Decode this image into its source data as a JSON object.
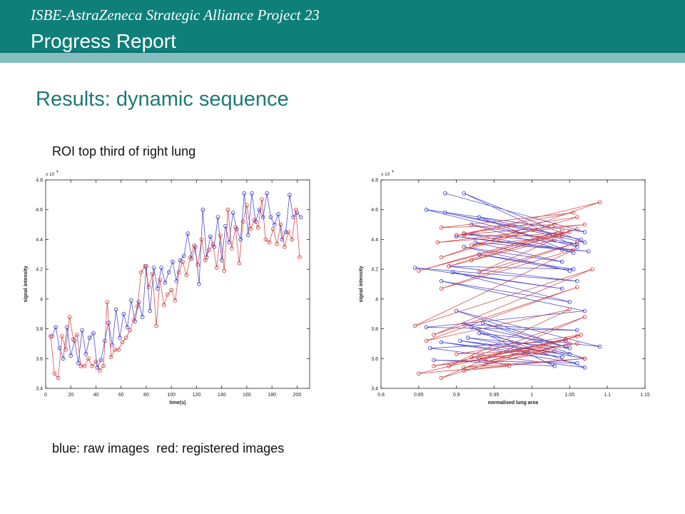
{
  "header": {
    "project_title": "ISBE-AstraZeneca Strategic Alliance Project 23",
    "report_title": "Progress Report"
  },
  "section_title": "Results: dynamic sequence",
  "roi_caption": "ROI top third of right lung",
  "legend": {
    "blue_label": "blue: raw images",
    "red_label": "red: registered images"
  },
  "colors": {
    "header_bg": "#0e7f79",
    "header_strip": "#83bfc0",
    "title_text": "#1b7a76",
    "series_blue": "#3030c8",
    "series_red": "#d03030"
  },
  "chart_data": [
    {
      "type": "line",
      "xlabel": "time(s)",
      "ylabel": "signal intensity",
      "y_multiplier": "x 10^4",
      "xlim": [
        0,
        210
      ],
      "ylim": [
        3.4,
        4.8
      ],
      "xticks": [
        0,
        20,
        40,
        60,
        80,
        100,
        120,
        140,
        160,
        180,
        200
      ],
      "yticks": [
        3.4,
        3.6,
        3.8,
        4.0,
        4.2,
        4.4,
        4.6,
        4.8
      ],
      "ytick_labels": [
        "3.4",
        "3.6",
        "3.8",
        "4",
        "4.2",
        "4.4",
        "4.6",
        "4.8"
      ],
      "series": [
        {
          "name": "raw images",
          "color": "#3030c8",
          "x": [
            5,
            8,
            11,
            14,
            17,
            20,
            23,
            26,
            29,
            32,
            35,
            38,
            41,
            44,
            47,
            50,
            53,
            56,
            59,
            62,
            65,
            68,
            71,
            74,
            77,
            80,
            83,
            86,
            89,
            92,
            95,
            98,
            101,
            104,
            107,
            110,
            113,
            116,
            119,
            122,
            125,
            128,
            131,
            134,
            137,
            140,
            143,
            146,
            149,
            152,
            155,
            158,
            161,
            164,
            167,
            170,
            173,
            176,
            179,
            182,
            185,
            188,
            191,
            194,
            197,
            200,
            203
          ],
          "values": [
            3.75,
            3.81,
            3.67,
            3.6,
            3.81,
            3.62,
            3.72,
            3.57,
            3.79,
            3.63,
            3.74,
            3.77,
            3.54,
            3.59,
            3.72,
            3.84,
            3.69,
            3.93,
            3.74,
            3.9,
            3.81,
            3.99,
            3.85,
            3.98,
            3.88,
            4.22,
            3.92,
            4.21,
            4.07,
            4.21,
            4.11,
            4.18,
            4.25,
            4.12,
            4.26,
            4.29,
            4.44,
            4.27,
            4.35,
            4.1,
            4.6,
            4.28,
            4.42,
            4.35,
            4.55,
            4.26,
            4.49,
            4.38,
            4.58,
            4.47,
            4.4,
            4.71,
            4.43,
            4.71,
            4.52,
            4.6,
            4.55,
            4.71,
            4.55,
            4.5,
            4.57,
            4.4,
            4.45,
            4.7,
            4.55,
            4.58,
            4.55
          ]
        },
        {
          "name": "registered images",
          "color": "#d03030",
          "x": [
            4,
            7,
            10,
            13,
            16,
            19,
            22,
            25,
            28,
            31,
            34,
            37,
            40,
            43,
            46,
            49,
            52,
            55,
            58,
            61,
            64,
            67,
            70,
            73,
            76,
            79,
            82,
            85,
            88,
            91,
            94,
            97,
            100,
            103,
            106,
            109,
            112,
            115,
            118,
            121,
            124,
            127,
            130,
            133,
            136,
            139,
            142,
            145,
            148,
            151,
            154,
            157,
            160,
            163,
            166,
            169,
            172,
            175,
            178,
            181,
            184,
            187,
            190,
            193,
            196,
            199,
            202
          ],
          "values": [
            3.75,
            3.5,
            3.47,
            3.75,
            3.66,
            3.88,
            3.73,
            3.76,
            3.55,
            3.55,
            3.6,
            3.55,
            3.58,
            3.52,
            3.55,
            3.98,
            3.61,
            3.66,
            3.66,
            3.71,
            3.74,
            3.79,
            3.86,
            3.95,
            4.18,
            4.22,
            4.08,
            4.17,
            3.82,
            4.13,
            3.96,
            4.03,
            4.06,
            3.99,
            4.18,
            4.25,
            4.16,
            4.28,
            4.36,
            4.23,
            4.4,
            4.26,
            4.33,
            4.37,
            4.21,
            4.43,
            4.19,
            4.6,
            4.34,
            4.48,
            4.24,
            4.52,
            4.63,
            4.47,
            4.53,
            4.48,
            4.67,
            4.4,
            4.38,
            4.47,
            4.37,
            4.5,
            4.35,
            4.45,
            4.4,
            4.6,
            4.28
          ]
        }
      ]
    },
    {
      "type": "scatter",
      "xlabel": "normalised lung area",
      "ylabel": "signal intensity",
      "y_multiplier": "x 10^4",
      "xlim": [
        0.8,
        1.15
      ],
      "ylim": [
        3.4,
        4.8
      ],
      "xticks": [
        0.8,
        0.85,
        0.9,
        0.95,
        1.0,
        1.05,
        1.1,
        1.15
      ],
      "xtick_labels": [
        "0.8",
        "0.85",
        "0.9",
        "0.95",
        "1",
        "1.05",
        "1.1",
        "1.15"
      ],
      "yticks": [
        3.4,
        3.6,
        3.8,
        4.0,
        4.2,
        4.4,
        4.6,
        4.8
      ],
      "ytick_labels": [
        "3.4",
        "3.6",
        "3.8",
        "4",
        "4.2",
        "4.4",
        "4.6",
        "4.8"
      ],
      "series": [
        {
          "name": "raw images",
          "color": "#3030c8",
          "x": [
            0.885,
            1.07,
            0.86,
            1.06,
            0.91,
            1.07,
            0.885,
            1.065,
            0.93,
            1.055,
            0.92,
            1.06,
            0.91,
            1.04,
            0.9,
            1.075,
            0.925,
            1.04,
            0.91,
            1.05,
            0.93,
            1.055,
            0.89,
            1.06,
            0.845,
            1.04,
            0.895,
            1.05,
            0.88,
            1.07,
            0.86,
            1.06,
            0.91,
            1.045,
            0.935,
            1.07,
            0.915,
            1.05,
            0.9,
            1.09,
            0.93,
            1.05,
            0.905,
            1.04,
            0.88,
            1.06,
            0.87,
            1.03,
            0.92,
            1.07,
            0.865,
            1.045
          ],
          "values": [
            4.71,
            4.45,
            4.6,
            4.35,
            4.71,
            4.38,
            4.58,
            4.4,
            4.55,
            4.31,
            4.5,
            4.37,
            4.44,
            4.33,
            4.42,
            4.32,
            4.38,
            4.25,
            4.35,
            4.19,
            4.3,
            4.2,
            4.22,
            4.12,
            4.21,
            4.07,
            4.18,
            3.98,
            4.12,
            3.92,
            3.81,
            3.79,
            3.83,
            3.68,
            3.84,
            3.6,
            3.74,
            3.67,
            3.92,
            3.68,
            3.77,
            3.63,
            3.72,
            3.61,
            3.71,
            3.57,
            3.59,
            3.55,
            3.81,
            3.54,
            3.67,
            3.72
          ]
        },
        {
          "name": "registered images",
          "color": "#d03030",
          "x": [
            0.91,
            1.09,
            0.88,
            1.06,
            0.91,
            1.055,
            0.88,
            1.03,
            0.92,
            1.04,
            0.9,
            1.07,
            0.875,
            1.05,
            0.92,
            1.06,
            0.85,
            1.04,
            0.89,
            1.03,
            0.93,
            1.06,
            0.88,
            1.055,
            0.845,
            1.08,
            0.87,
            1.06,
            0.86,
            1.05,
            0.89,
            1.07,
            0.88,
            1.06,
            0.93,
            1.03,
            0.91,
            1.07,
            0.85,
            1.045,
            0.87,
            1.02,
            0.9,
            1.065,
            0.94,
            1.05,
            0.91,
            0.97,
            0.92,
            1.06
          ],
          "values": [
            4.43,
            4.65,
            4.28,
            4.55,
            4.44,
            4.58,
            4.48,
            4.5,
            4.36,
            4.42,
            4.43,
            4.5,
            4.38,
            4.45,
            4.26,
            4.47,
            4.19,
            4.46,
            4.22,
            4.4,
            4.18,
            4.38,
            4.07,
            4.33,
            3.82,
            4.2,
            3.76,
            4.08,
            3.72,
            3.93,
            3.55,
            3.88,
            3.47,
            3.75,
            3.6,
            3.65,
            3.54,
            3.6,
            3.5,
            3.73,
            3.55,
            3.66,
            3.63,
            3.76,
            3.58,
            3.7,
            3.52,
            3.55,
            3.61,
            3.7
          ]
        }
      ]
    }
  ]
}
